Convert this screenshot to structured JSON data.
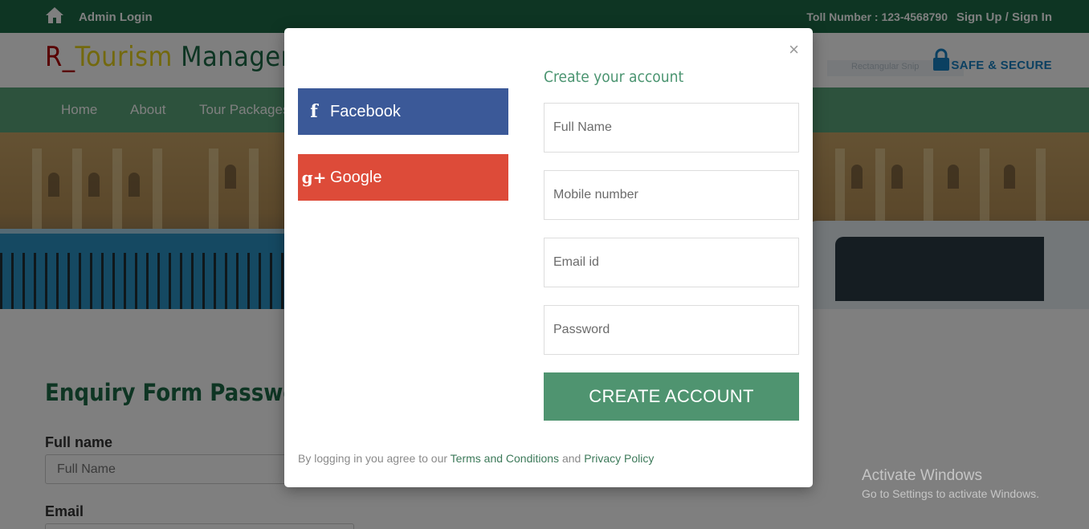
{
  "topbar": {
    "admin_login": "Admin Login",
    "toll_number": "Toll Number : 123-4568790",
    "signup": "Sign Up / Sign In"
  },
  "header": {
    "logo_part1": "R_",
    "logo_part2": "Tourism",
    "logo_part3": " Management System",
    "safe_secure": "SAFE & SECURE",
    "ghost_ad": "Rectangular Snip"
  },
  "nav": {
    "items": [
      "Home",
      "About",
      "Tour Packages"
    ]
  },
  "page_form": {
    "title": "Enquiry Form Password",
    "label_full_name": "Full name",
    "full_name_placeholder": "Full Name",
    "label_email": "Email"
  },
  "modal": {
    "close": "×",
    "facebook_label": "Facebook",
    "google_label": "Google",
    "create_title": "Create your account",
    "full_name_placeholder": "Full Name",
    "mobile_placeholder": "Mobile number",
    "email_placeholder": "Email id",
    "password_placeholder": "Password",
    "create_button": "CREATE ACCOUNT",
    "terms_prefix": "By logging in you agree to our ",
    "terms_link": "Terms and Conditions",
    "terms_and": " and ",
    "privacy_link": "Privacy Policy"
  },
  "watermark": {
    "line1": "Activate Windows",
    "line2": "Go to Settings to activate Windows."
  },
  "colors": {
    "topbar": "#1c6b47",
    "nav": "#5aa57a",
    "facebook": "#3b5998",
    "google": "#dd4b39",
    "create_button": "#4f9470"
  }
}
